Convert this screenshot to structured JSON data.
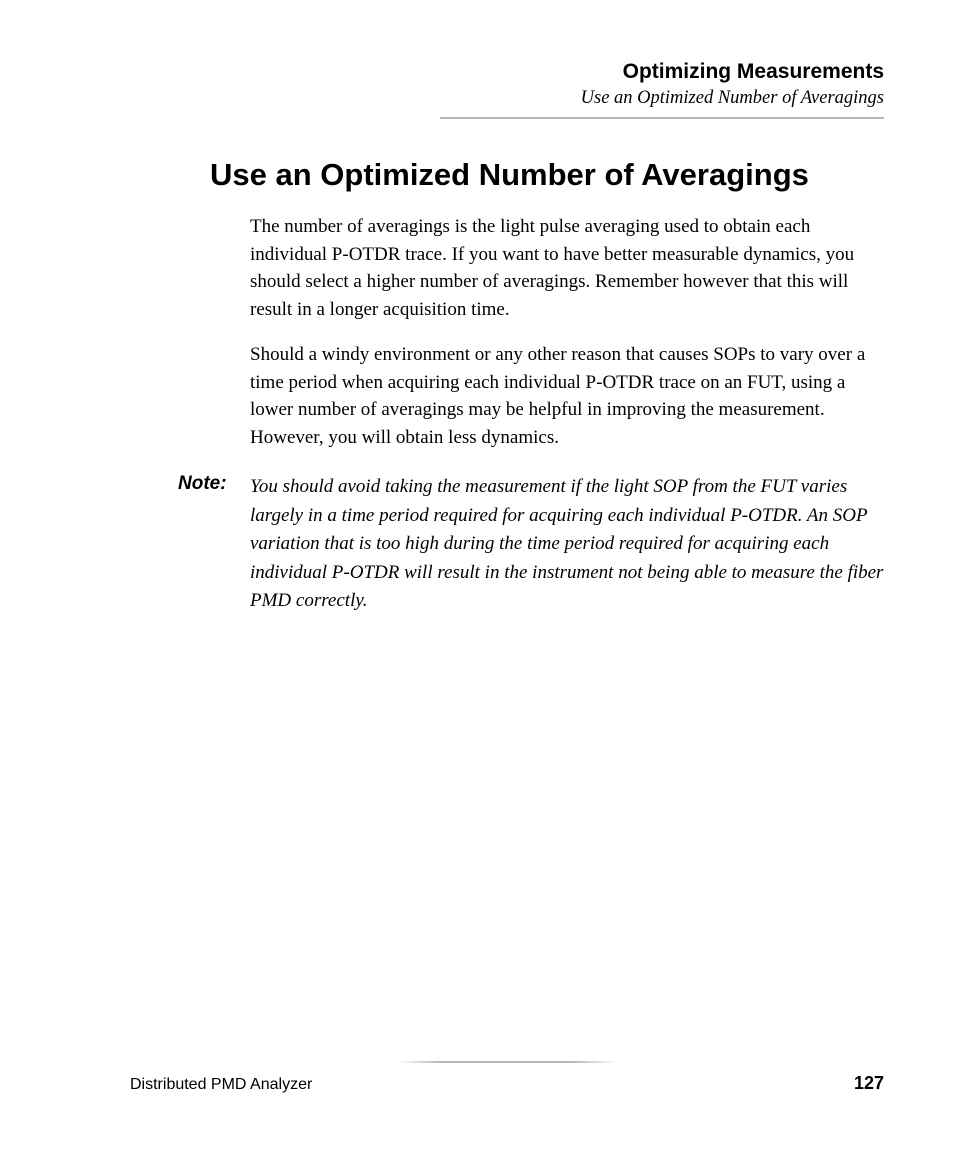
{
  "header": {
    "chapter": "Optimizing Measurements",
    "section": "Use an Optimized Number of Averagings"
  },
  "heading": "Use an Optimized Number of Averagings",
  "paragraphs": [
    "The number of averagings is the light pulse averaging used to obtain each individual P-OTDR trace. If you want to have better measurable dynamics, you should select a higher number of averagings. Remember however that this will result in a longer acquisition time.",
    "Should a windy environment or any other reason that causes SOPs to vary over a time period when acquiring each individual P-OTDR trace on an FUT, using a lower number of averagings may be helpful in improving the measurement. However, you will obtain less dynamics."
  ],
  "note": {
    "label": "Note:",
    "text": "You should avoid taking the measurement if the light SOP from the FUT varies largely in a time period required for acquiring each individual P-OTDR. An SOP variation that is too high during the time period required for acquiring each individual P-OTDR will result in the instrument not being able to measure the fiber PMD correctly."
  },
  "footer": {
    "left": "Distributed PMD Analyzer",
    "page": "127"
  }
}
